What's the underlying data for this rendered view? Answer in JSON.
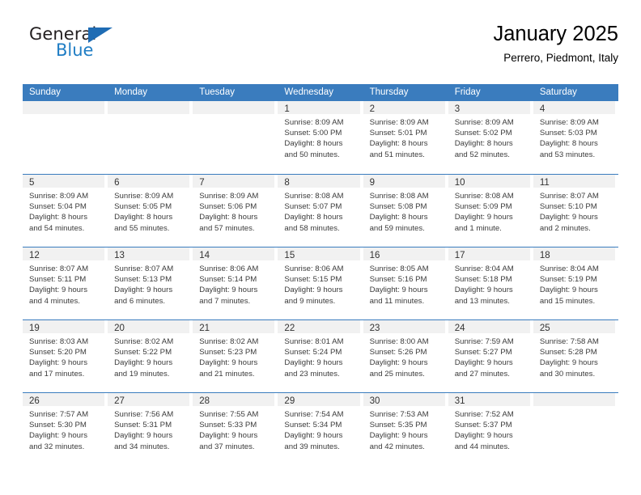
{
  "brand": {
    "name_top": "General",
    "name_bottom": "Blue",
    "triangle_icon": "blue-triangle-logo-mark",
    "color_dark": "#231f20",
    "color_blue": "#1f7dc4"
  },
  "header": {
    "title": "January 2025",
    "subtitle": "Perrero, Piedmont, Italy"
  },
  "theme": {
    "header_bar": "#3a7cbe",
    "day_band": "#f1f1f1",
    "rule": "#3a7cbe",
    "text": "#3b3b3b"
  },
  "weekdays": [
    "Sunday",
    "Monday",
    "Tuesday",
    "Wednesday",
    "Thursday",
    "Friday",
    "Saturday"
  ],
  "weeks": [
    [
      {
        "day": "",
        "lines": []
      },
      {
        "day": "",
        "lines": []
      },
      {
        "day": "",
        "lines": []
      },
      {
        "day": "1",
        "lines": [
          "Sunrise: 8:09 AM",
          "Sunset: 5:00 PM",
          "Daylight: 8 hours",
          "and 50 minutes."
        ]
      },
      {
        "day": "2",
        "lines": [
          "Sunrise: 8:09 AM",
          "Sunset: 5:01 PM",
          "Daylight: 8 hours",
          "and 51 minutes."
        ]
      },
      {
        "day": "3",
        "lines": [
          "Sunrise: 8:09 AM",
          "Sunset: 5:02 PM",
          "Daylight: 8 hours",
          "and 52 minutes."
        ]
      },
      {
        "day": "4",
        "lines": [
          "Sunrise: 8:09 AM",
          "Sunset: 5:03 PM",
          "Daylight: 8 hours",
          "and 53 minutes."
        ]
      }
    ],
    [
      {
        "day": "5",
        "lines": [
          "Sunrise: 8:09 AM",
          "Sunset: 5:04 PM",
          "Daylight: 8 hours",
          "and 54 minutes."
        ]
      },
      {
        "day": "6",
        "lines": [
          "Sunrise: 8:09 AM",
          "Sunset: 5:05 PM",
          "Daylight: 8 hours",
          "and 55 minutes."
        ]
      },
      {
        "day": "7",
        "lines": [
          "Sunrise: 8:09 AM",
          "Sunset: 5:06 PM",
          "Daylight: 8 hours",
          "and 57 minutes."
        ]
      },
      {
        "day": "8",
        "lines": [
          "Sunrise: 8:08 AM",
          "Sunset: 5:07 PM",
          "Daylight: 8 hours",
          "and 58 minutes."
        ]
      },
      {
        "day": "9",
        "lines": [
          "Sunrise: 8:08 AM",
          "Sunset: 5:08 PM",
          "Daylight: 8 hours",
          "and 59 minutes."
        ]
      },
      {
        "day": "10",
        "lines": [
          "Sunrise: 8:08 AM",
          "Sunset: 5:09 PM",
          "Daylight: 9 hours",
          "and 1 minute."
        ]
      },
      {
        "day": "11",
        "lines": [
          "Sunrise: 8:07 AM",
          "Sunset: 5:10 PM",
          "Daylight: 9 hours",
          "and 2 minutes."
        ]
      }
    ],
    [
      {
        "day": "12",
        "lines": [
          "Sunrise: 8:07 AM",
          "Sunset: 5:11 PM",
          "Daylight: 9 hours",
          "and 4 minutes."
        ]
      },
      {
        "day": "13",
        "lines": [
          "Sunrise: 8:07 AM",
          "Sunset: 5:13 PM",
          "Daylight: 9 hours",
          "and 6 minutes."
        ]
      },
      {
        "day": "14",
        "lines": [
          "Sunrise: 8:06 AM",
          "Sunset: 5:14 PM",
          "Daylight: 9 hours",
          "and 7 minutes."
        ]
      },
      {
        "day": "15",
        "lines": [
          "Sunrise: 8:06 AM",
          "Sunset: 5:15 PM",
          "Daylight: 9 hours",
          "and 9 minutes."
        ]
      },
      {
        "day": "16",
        "lines": [
          "Sunrise: 8:05 AM",
          "Sunset: 5:16 PM",
          "Daylight: 9 hours",
          "and 11 minutes."
        ]
      },
      {
        "day": "17",
        "lines": [
          "Sunrise: 8:04 AM",
          "Sunset: 5:18 PM",
          "Daylight: 9 hours",
          "and 13 minutes."
        ]
      },
      {
        "day": "18",
        "lines": [
          "Sunrise: 8:04 AM",
          "Sunset: 5:19 PM",
          "Daylight: 9 hours",
          "and 15 minutes."
        ]
      }
    ],
    [
      {
        "day": "19",
        "lines": [
          "Sunrise: 8:03 AM",
          "Sunset: 5:20 PM",
          "Daylight: 9 hours",
          "and 17 minutes."
        ]
      },
      {
        "day": "20",
        "lines": [
          "Sunrise: 8:02 AM",
          "Sunset: 5:22 PM",
          "Daylight: 9 hours",
          "and 19 minutes."
        ]
      },
      {
        "day": "21",
        "lines": [
          "Sunrise: 8:02 AM",
          "Sunset: 5:23 PM",
          "Daylight: 9 hours",
          "and 21 minutes."
        ]
      },
      {
        "day": "22",
        "lines": [
          "Sunrise: 8:01 AM",
          "Sunset: 5:24 PM",
          "Daylight: 9 hours",
          "and 23 minutes."
        ]
      },
      {
        "day": "23",
        "lines": [
          "Sunrise: 8:00 AM",
          "Sunset: 5:26 PM",
          "Daylight: 9 hours",
          "and 25 minutes."
        ]
      },
      {
        "day": "24",
        "lines": [
          "Sunrise: 7:59 AM",
          "Sunset: 5:27 PM",
          "Daylight: 9 hours",
          "and 27 minutes."
        ]
      },
      {
        "day": "25",
        "lines": [
          "Sunrise: 7:58 AM",
          "Sunset: 5:28 PM",
          "Daylight: 9 hours",
          "and 30 minutes."
        ]
      }
    ],
    [
      {
        "day": "26",
        "lines": [
          "Sunrise: 7:57 AM",
          "Sunset: 5:30 PM",
          "Daylight: 9 hours",
          "and 32 minutes."
        ]
      },
      {
        "day": "27",
        "lines": [
          "Sunrise: 7:56 AM",
          "Sunset: 5:31 PM",
          "Daylight: 9 hours",
          "and 34 minutes."
        ]
      },
      {
        "day": "28",
        "lines": [
          "Sunrise: 7:55 AM",
          "Sunset: 5:33 PM",
          "Daylight: 9 hours",
          "and 37 minutes."
        ]
      },
      {
        "day": "29",
        "lines": [
          "Sunrise: 7:54 AM",
          "Sunset: 5:34 PM",
          "Daylight: 9 hours",
          "and 39 minutes."
        ]
      },
      {
        "day": "30",
        "lines": [
          "Sunrise: 7:53 AM",
          "Sunset: 5:35 PM",
          "Daylight: 9 hours",
          "and 42 minutes."
        ]
      },
      {
        "day": "31",
        "lines": [
          "Sunrise: 7:52 AM",
          "Sunset: 5:37 PM",
          "Daylight: 9 hours",
          "and 44 minutes."
        ]
      },
      {
        "day": "",
        "lines": []
      }
    ]
  ]
}
